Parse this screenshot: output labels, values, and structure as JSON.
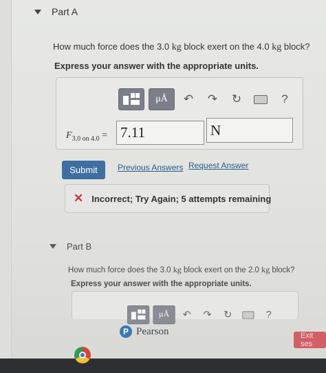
{
  "part_a": {
    "title": "Part A",
    "question": [
      "How much force does the 3.0 ",
      "kg",
      " block exert on the 4.0 ",
      "kg",
      " block?"
    ],
    "instruction": "Express your answer with the appropriate units.",
    "toolbar": {
      "units_label": "μÅ",
      "help_label": "?"
    },
    "variable": "F",
    "subscript": "3.0 on 4.0",
    "equals": " =",
    "value": "7.11",
    "units": "N",
    "submit_label": "Submit",
    "previous_answers": "Previous Answers",
    "request_answer": "Request Answer",
    "feedback": "Incorrect; Try Again; 5 attempts remaining"
  },
  "part_b": {
    "title": "Part B",
    "question": [
      "How much force does the 3.0 ",
      "kg",
      " block exert on the 2.0 ",
      "kg",
      " block?"
    ],
    "instruction": "Express your answer with the appropriate units.",
    "toolbar": {
      "units_label": "μÅ",
      "help_label": "?"
    }
  },
  "footer": {
    "brand": "Pearson",
    "logo_letter": "P",
    "exit_label": "Exit ses"
  },
  "colors": {
    "submit": "#3e6fa0",
    "link": "#2a5a8d",
    "error": "#c03b3b",
    "exit": "#d35f66"
  }
}
